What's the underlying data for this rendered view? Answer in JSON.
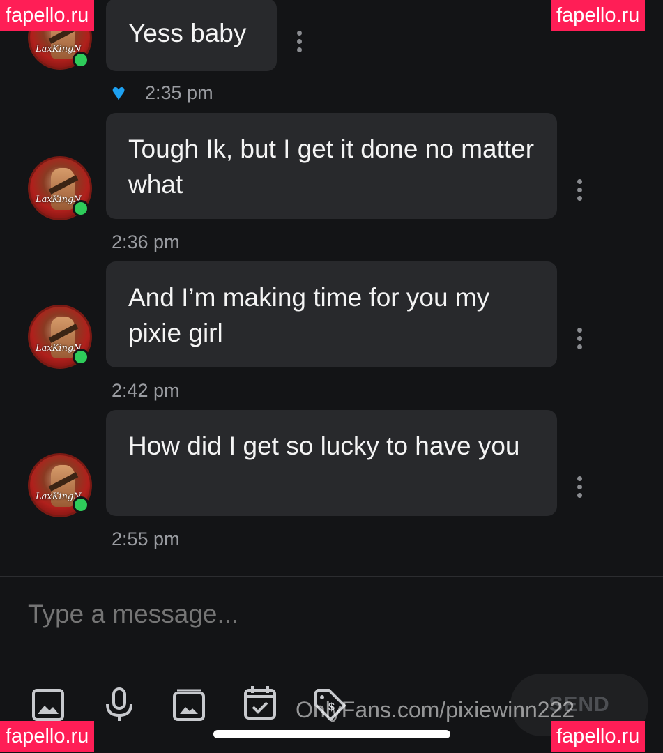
{
  "messages": [
    {
      "text": "Yess baby",
      "time": "2:35 pm",
      "liked": true
    },
    {
      "text": "Tough Ik, but I get it done no matter what",
      "time": "2:36 pm"
    },
    {
      "text": "And I’m making time for you my pixie girl",
      "time": "2:42 pm"
    },
    {
      "text": "How did I get so lucky to have you",
      "time": "2:55 pm"
    }
  ],
  "avatar_signature": "LaxKingN",
  "composer": {
    "placeholder": "Type a message...",
    "send_label": "SEND"
  },
  "toolbar_icons": [
    "image-icon",
    "microphone-icon",
    "media-vault-icon",
    "calendar-check-icon",
    "price-tag-icon"
  ],
  "watermark": "OnlyFans.com/pixiewinn222",
  "site_badge": "fapello.ru",
  "colors": {
    "online": "#2ecc5a",
    "heart": "#1da1f2",
    "badge": "#ff1e56"
  }
}
